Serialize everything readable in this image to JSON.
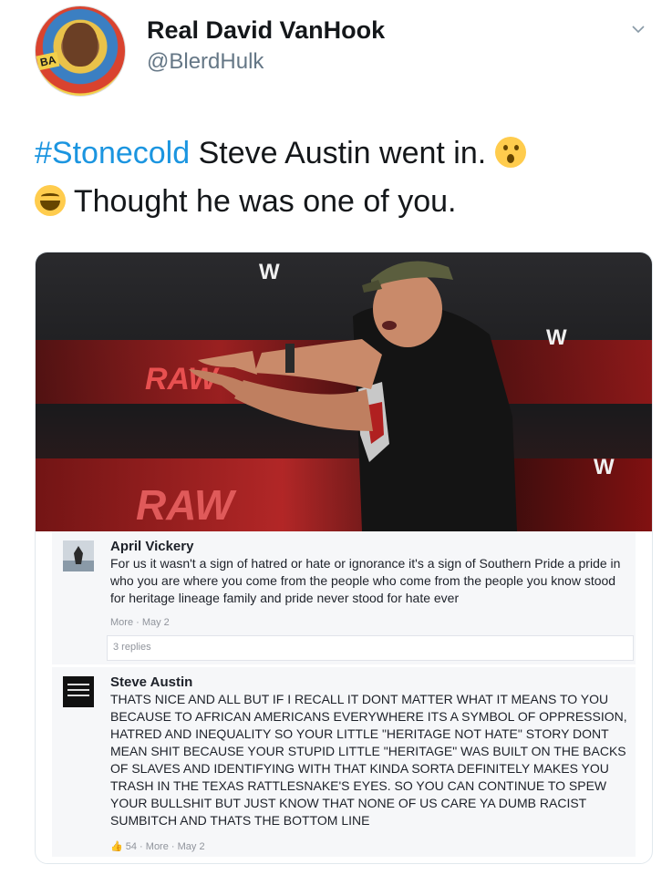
{
  "author": {
    "name": "Real David VanHook",
    "handle": "@BlerdHulk",
    "avatar_icon": "profile-photo"
  },
  "tweet": {
    "hashtag": "#Stonecold",
    "line1_rest": " Steve Austin went in. ",
    "line2_rest": " Thought he was one of you.",
    "emojis": [
      "hushed-face-emoji",
      "tears-of-joy-emoji"
    ]
  },
  "photo": {
    "description_icon": "wrestler-photo",
    "logo_text_1": "RAW",
    "logo_text_2": "RAW"
  },
  "comments": [
    {
      "name": "April Vickery",
      "body": "For us it wasn't a sign of hatred or hate or ignorance it's a sign of Southern Pride a pride in who you are where you come from the people who come from the people you know stood for heritage lineage family and pride never stood for hate ever",
      "meta": "More · May 2",
      "replies": "3 replies"
    },
    {
      "name": "Steve Austin",
      "body": "THATS NICE AND ALL BUT IF I RECALL IT DONT MATTER WHAT IT MEANS TO YOU BECAUSE TO AFRICAN AMERICANS EVERYWHERE ITS A SYMBOL OF OPPRESSION, HATRED AND INEQUALITY SO YOUR LITTLE \"HERITAGE NOT HATE\" STORY DONT MEAN SHIT BECAUSE YOUR STUPID LITTLE \"HERITAGE\" WAS BUILT ON THE BACKS OF SLAVES AND IDENTIFYING WITH THAT KINDA SORTA DEFINITELY MAKES YOU TRASH IN THE TEXAS RATTLESNAKE'S EYES. SO YOU CAN CONTINUE TO SPEW YOUR BULLSHIT BUT JUST KNOW THAT NONE OF US CARE YA DUMB RACIST SUMBITCH AND THATS THE BOTTOM LINE",
      "meta": "54 · More · May 2"
    }
  ],
  "colors": {
    "hashtag": "#1b95e0",
    "handle": "#657786",
    "text": "#14171a"
  }
}
